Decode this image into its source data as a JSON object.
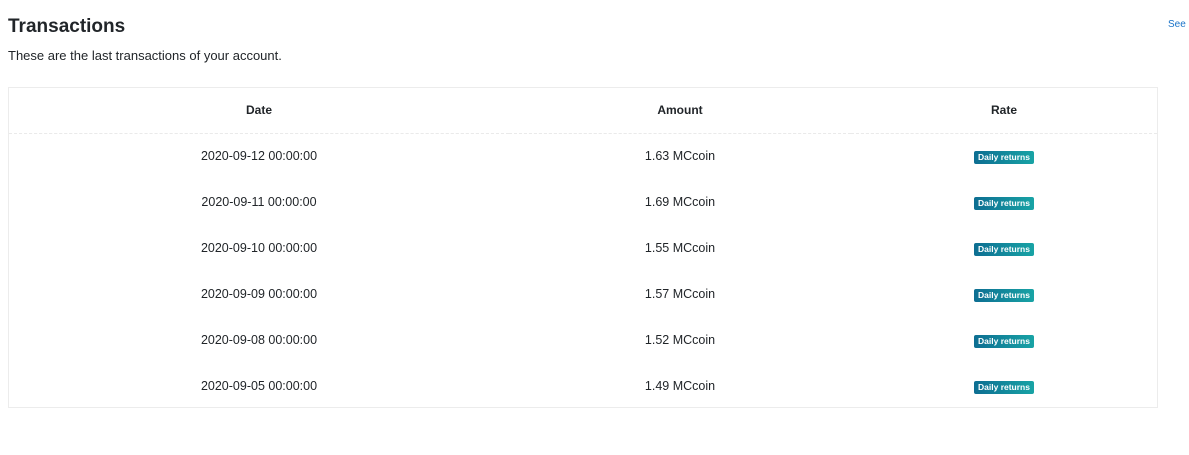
{
  "header": {
    "title": "Transactions",
    "subtitle": "These are the last transactions of your account.",
    "see_all_label": "See a"
  },
  "table": {
    "columns": [
      "Date",
      "Amount",
      "Rate"
    ],
    "rows": [
      {
        "date": "2020-09-12 00:00:00",
        "amount": "1.63 MCcoin",
        "rate": "Daily returns"
      },
      {
        "date": "2020-09-11 00:00:00",
        "amount": "1.69 MCcoin",
        "rate": "Daily returns"
      },
      {
        "date": "2020-09-10 00:00:00",
        "amount": "1.55 MCcoin",
        "rate": "Daily returns"
      },
      {
        "date": "2020-09-09 00:00:00",
        "amount": "1.57 MCcoin",
        "rate": "Daily returns"
      },
      {
        "date": "2020-09-08 00:00:00",
        "amount": "1.52 MCcoin",
        "rate": "Daily returns"
      },
      {
        "date": "2020-09-05 00:00:00",
        "amount": "1.49 MCcoin",
        "rate": "Daily returns"
      }
    ]
  },
  "colors": {
    "badge_start": "#0d6e92",
    "badge_end": "#18a3a5",
    "link": "#1a73c8"
  }
}
